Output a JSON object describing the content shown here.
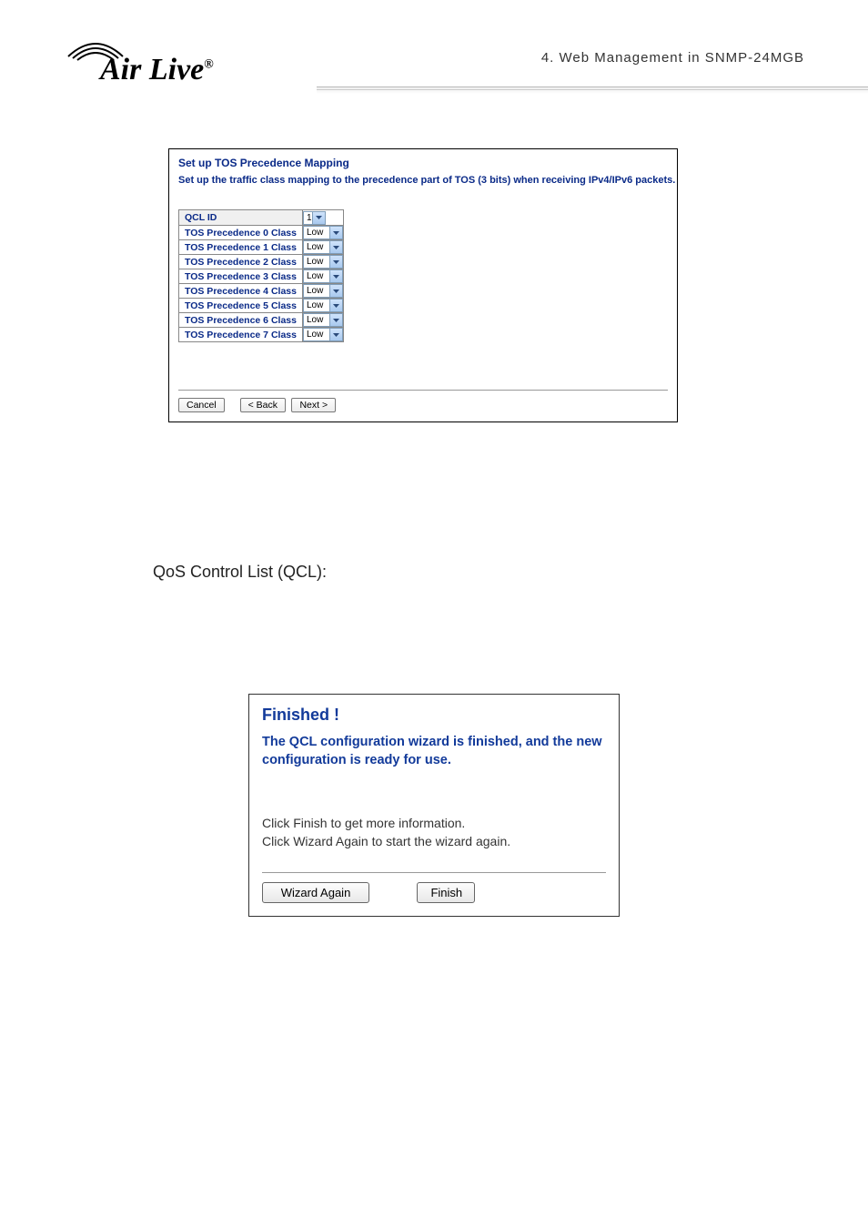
{
  "header": {
    "breadcrumb": "4.   Web  Management  in  SNMP-24MGB",
    "logo_text": "Air Live",
    "logo_reg": "®"
  },
  "panel1": {
    "title": "Set up TOS Precedence Mapping",
    "subtitle": "Set up the traffic class mapping to the precedence part of TOS (3 bits) when receiving IPv4/IPv6 packets.",
    "qcl_label": "QCL ID",
    "qcl_value": "1",
    "rows": [
      {
        "label": "TOS Precedence 0 Class",
        "value": "Low"
      },
      {
        "label": "TOS Precedence 1 Class",
        "value": "Low"
      },
      {
        "label": "TOS Precedence 2 Class",
        "value": "Low"
      },
      {
        "label": "TOS Precedence 3 Class",
        "value": "Low"
      },
      {
        "label": "TOS Precedence 4 Class",
        "value": "Low"
      },
      {
        "label": "TOS Precedence 5 Class",
        "value": "Low"
      },
      {
        "label": "TOS Precedence 6 Class",
        "value": "Low"
      },
      {
        "label": "TOS Precedence 7 Class",
        "value": "Low"
      }
    ],
    "buttons": {
      "cancel": "Cancel",
      "back": "< Back",
      "next": "Next >"
    }
  },
  "section_label": "QoS Control List (QCL):",
  "panel2": {
    "title": "Finished !",
    "subtitle": "The QCL configuration wizard is finished, and the new configuration is ready for use.",
    "body_line1": "Click Finish to get more information.",
    "body_line2": "Click Wizard Again to start the wizard again.",
    "buttons": {
      "wizard_again": "Wizard Again",
      "finish": "Finish"
    }
  }
}
